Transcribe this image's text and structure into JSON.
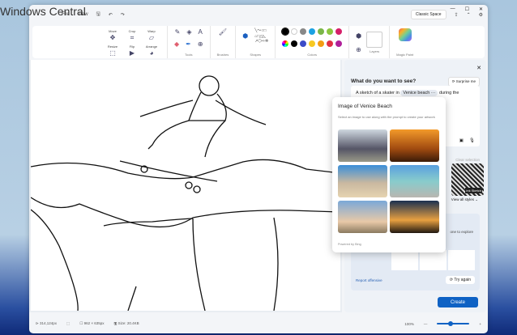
{
  "watermark": "Windows Central",
  "menu": {
    "file": "File",
    "view": "View"
  },
  "window": {
    "space": "Classic Space",
    "minimize": "—",
    "maximize": "☐",
    "close": "✕"
  },
  "ribbon": {
    "image_tools": [
      "Move",
      "Crop",
      "Warp",
      "Resize",
      "Flip",
      "Arrange"
    ],
    "groups": {
      "tools": "Tools",
      "brushes": "Brushes",
      "shapes": "Shapes",
      "colors": "Colors",
      "layers": "Layers",
      "magic": "Magic Paint"
    },
    "colors_row1": [
      "#000000",
      "#ffffff",
      "#888888",
      "#1ba1e2",
      "#7ab648",
      "#8cc63f",
      "#d61f69"
    ],
    "colors_row2": [
      "#000000",
      "#3b4bc8",
      "#f7c821",
      "#f39c12",
      "#e02f44",
      "#b0209a"
    ]
  },
  "panel": {
    "title": "What do you want to see?",
    "surprise": "Surprise me",
    "prompt_pre": "A sketch of a skater in",
    "prompt_chip": "Venice beach ···",
    "prompt_post": "during the",
    "clear": "Clear selection",
    "style_label": "Ink Sketch",
    "view_all": "View all styles ⌄",
    "explore": "one to explore",
    "report": "Report offensive",
    "try_again": "Try again",
    "create": "Create"
  },
  "popup": {
    "title": "Image of Venice Beach",
    "desc": "Select an image to use along with the prompt to create your artwork",
    "powered": "Powered by Bing"
  },
  "status": {
    "cursor": "314,124px",
    "dims": "962 × 635px",
    "size": "Size: 20.4KB",
    "zoom": "100%",
    "minus": "—",
    "plus": "+"
  }
}
